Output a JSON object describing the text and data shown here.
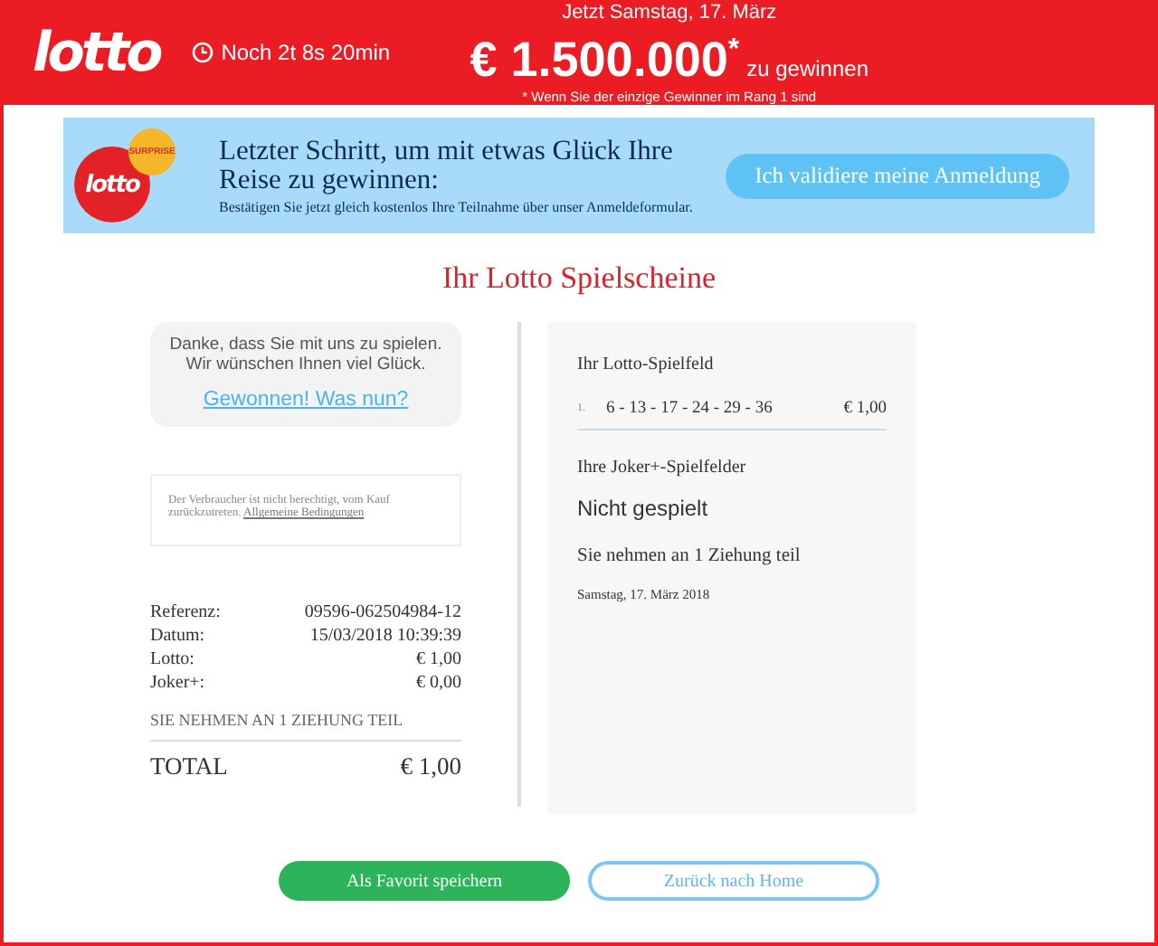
{
  "header": {
    "logo": "lotto",
    "countdown": "Noch 2t 8s 20min",
    "draw_label": "Jetzt Samstag, 17. März",
    "jackpot": "€ 1.500.000",
    "jackpot_mark": "*",
    "jackpot_suffix": "zu gewinnen",
    "footnote": "* Wenn Sie der einzige Gewinner im Rang 1 sind"
  },
  "banner": {
    "logo": "lotto",
    "badge": "SURPRISE",
    "title": "Letzter Schritt, um mit etwas Glück Ihre Reise zu gewinnen:",
    "subtitle": "Bestätigen Sie jetzt gleich kostenlos Ihre Teilnahme über unser Anmeldeformular.",
    "button": "Ich validiere meine Anmeldung"
  },
  "page_title": "Ihr Lotto Spielscheine",
  "thanks": {
    "text": "Danke, dass Sie mit uns zu spielen. Wir wünschen Ihnen viel Glück.",
    "link": "Gewonnen! Was nun?"
  },
  "notice": {
    "text": "Der Verbraucher ist nicht berechtigt, vom Kauf zurückzutreten.",
    "link": "Allgemeine Bedingungen"
  },
  "summary": [
    {
      "label": "Referenz:",
      "value": "09596-062504984-12"
    },
    {
      "label": "Datum:",
      "value": "15/03/2018 10:39:39"
    },
    {
      "label": "Lotto:",
      "value": "€ 1,00"
    },
    {
      "label": "Joker+:",
      "value": "€ 0,00"
    }
  ],
  "draws_note": "SIE NEHMEN AN 1 ZIEHUNG TEIL",
  "total": {
    "label": "TOTAL",
    "value": "€ 1,00"
  },
  "lotto_field": {
    "title": "Ihr Lotto-Spielfeld",
    "rows": [
      {
        "index": "1.",
        "numbers": "6 - 13 - 17 - 24 - 29 - 36",
        "price": "€ 1,00"
      }
    ]
  },
  "joker": {
    "title": "Ihre Joker+-Spielfelder",
    "status": "Nicht gespielt"
  },
  "draws": {
    "text": "Sie nehmen an 1 Ziehung teil",
    "dates": [
      "Samstag, 17. März 2018"
    ]
  },
  "buttons": [
    {
      "label": "Als Favorit speichern",
      "kind": "primary"
    },
    {
      "label": "Zurück nach Home",
      "kind": "outline"
    }
  ]
}
